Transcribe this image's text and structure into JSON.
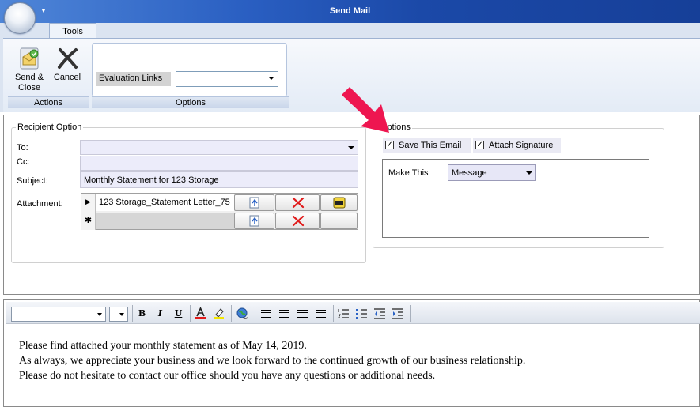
{
  "window": {
    "title": "Send Mail"
  },
  "ribbon": {
    "tab": "Tools",
    "actions": {
      "group_label": "Actions",
      "send_close": [
        "Send &",
        "Close"
      ],
      "cancel": "Cancel"
    },
    "options": {
      "group_label": "Options",
      "evaluation_links_label": "Evaluation Links",
      "evaluation_links_value": ""
    }
  },
  "recipient_option": {
    "legend": "Recipient Option",
    "to_label": "To:",
    "to_value": "",
    "cc_label": "Cc:",
    "cc_value": "",
    "subject_label": "Subject:",
    "subject_value": "Monthly Statement for 123 Storage",
    "attachment_label": "Attachment:",
    "attachments": [
      {
        "marker": "▶",
        "name": "123 Storage_Statement Letter_75"
      },
      {
        "marker": "✱",
        "name": ""
      }
    ]
  },
  "options_panel": {
    "legend": "Options",
    "save_email": {
      "label": "Save This Email",
      "checked": true
    },
    "attach_signature": {
      "label": "Attach Signature",
      "checked": true
    },
    "make_this_label": "Make This",
    "make_this_value": "Message"
  },
  "editor": {
    "toolbar": {
      "bold": "B",
      "italic": "I",
      "underline": "U"
    },
    "body": [
      "Please find attached your monthly statement as of May 14, 2019.",
      "As always, we appreciate your business and we look forward to the continued growth of our business relationship.",
      "Please do not hesitate to contact our office should you have any questions or additional needs."
    ]
  },
  "annotation": {
    "arrow_color": "#ee1650"
  }
}
